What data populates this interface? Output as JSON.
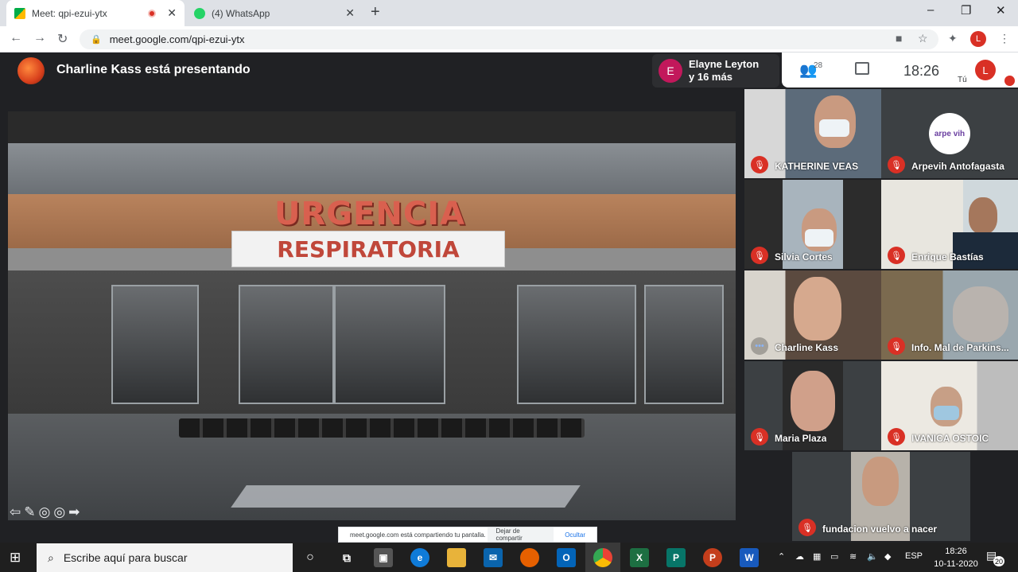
{
  "browser": {
    "tabs": [
      {
        "title": "Meet: qpi-ezui-ytx",
        "close": "✕"
      },
      {
        "title": "(4) WhatsApp",
        "close": "✕"
      }
    ],
    "newtab": "+",
    "window_controls": {
      "minimize": "–",
      "maximize": "❐",
      "close": "✕"
    },
    "url": "meet.google.com/qpi-ezui-ytx",
    "profile_initial": "L"
  },
  "meet": {
    "presenting_title": "Charline Kass está presentando",
    "presenters": {
      "initial": "E",
      "line1": "Elayne Leyton",
      "line2": "y 16 más"
    },
    "participant_count": "28",
    "time": "18:26",
    "self_label": "Tú",
    "self_initial": "L"
  },
  "slide": {
    "sign_top": "URGENCIA",
    "sign_bottom": "RESPIRATORIA"
  },
  "share_banner": {
    "text": "meet.google.com está compartiendo tu pantalla.",
    "stop": "Dejar de compartir",
    "hide": "Ocultar"
  },
  "participants": [
    {
      "name": "KATHERINE VEAS",
      "muted": true
    },
    {
      "name": "Arpevih Antofagasta",
      "muted": true,
      "logo": "arpe vih"
    },
    {
      "name": "Silvia Cortes",
      "muted": true
    },
    {
      "name": "Enrique Bastías",
      "muted": true
    },
    {
      "name": "Charline Kass",
      "muted": false
    },
    {
      "name": "Info. Mal de Parkins...",
      "muted": true
    },
    {
      "name": "Maria Plaza",
      "muted": true
    },
    {
      "name": "IVANICA OSTOIC",
      "muted": true
    },
    {
      "name": "fundacion vuelvo a nacer",
      "muted": true
    }
  ],
  "taskbar": {
    "search_placeholder": "Escribe aquí para buscar",
    "language": "ESP",
    "time": "18:26",
    "date": "10-11-2020",
    "notifications": "20"
  }
}
